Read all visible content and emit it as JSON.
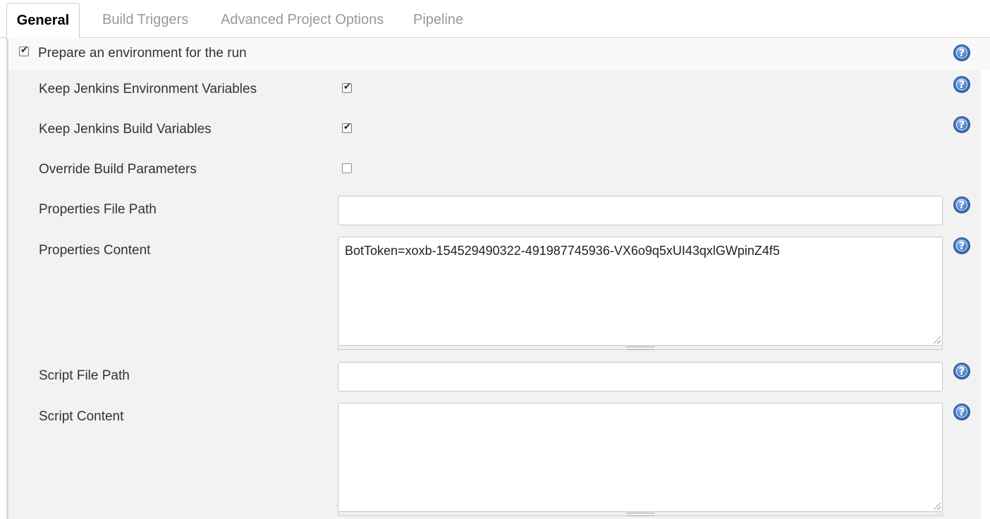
{
  "tabs": [
    {
      "label": "General",
      "active": true
    },
    {
      "label": "Build Triggers",
      "active": false
    },
    {
      "label": "Advanced Project Options",
      "active": false
    },
    {
      "label": "Pipeline",
      "active": false
    }
  ],
  "section": {
    "label": "Prepare an environment for the run",
    "checked": true
  },
  "fields": {
    "keep_env_vars": {
      "label": "Keep Jenkins Environment Variables",
      "checked": true
    },
    "keep_build_vars": {
      "label": "Keep Jenkins Build Variables",
      "checked": true
    },
    "override_params": {
      "label": "Override Build Parameters",
      "checked": false
    },
    "properties_file_path": {
      "label": "Properties File Path",
      "value": ""
    },
    "properties_content": {
      "label": "Properties Content",
      "value": "BotToken=xoxb-154529490322-491987745936-VX6o9q5xUI43qxlGWpinZ4f5"
    },
    "script_file_path": {
      "label": "Script File Path",
      "value": ""
    },
    "script_content": {
      "label": "Script Content",
      "value": ""
    }
  },
  "help_symbol": "?",
  "colors": {
    "help_icon": "#4a7cc4",
    "panel_background": "#f2f2f2",
    "active_tab_text": "#000000",
    "inactive_tab_text": "#999999"
  }
}
